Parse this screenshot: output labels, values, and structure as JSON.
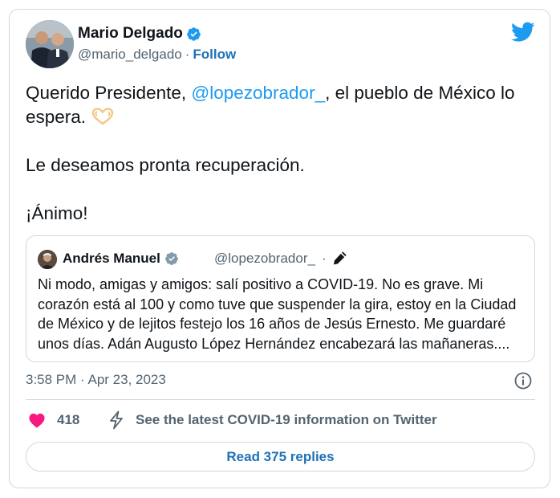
{
  "tweet": {
    "author_name": "Mario Delgado",
    "author_handle": "@mario_delgado",
    "separator": "·",
    "follow_label": "Follow",
    "text_line1_prefix": "Querido Presidente, ",
    "text_line1_mention": "@lopezobrador_",
    "text_line1_suffix": ", el pueblo de México lo espera.",
    "paragraph2": "Le deseamos pronta recuperación.",
    "paragraph3": "¡Ánimo!",
    "timestamp": "3:58 PM · Apr 23, 2023"
  },
  "quoted_tweet": {
    "author_name": "Andrés Manuel",
    "author_handle": "@lopezobrador_",
    "separator": "·",
    "text": "Ni modo, amigas y amigos: salí positivo a COVID-19. No es grave. Mi corazón está al 100 y como tuve que suspender la gira, estoy en la Ciudad de México y de lejitos festejo los 16 años de Jesús Ernesto. Me guardaré unos días. Adán Augusto López Hernández encabezará las mañaneras...."
  },
  "actions": {
    "like_count": "418",
    "covid_info_label": "See the latest COVID-19 information on Twitter",
    "read_replies_label": "Read 375 replies"
  },
  "icons": {
    "verified": "verified-badge-icon",
    "twitter": "twitter-bird-icon",
    "heart_hands": "heart-hands-emoji-icon",
    "edit": "pencil-edit-icon",
    "info": "info-icon",
    "like": "heart-icon",
    "covid": "lightning-bolt-icon"
  },
  "colors": {
    "accent_blue": "#1d9bf0",
    "link_blue": "#1d71b8",
    "like_pink": "#f91880",
    "muted_text": "#536471",
    "border": "#cfd9de"
  }
}
